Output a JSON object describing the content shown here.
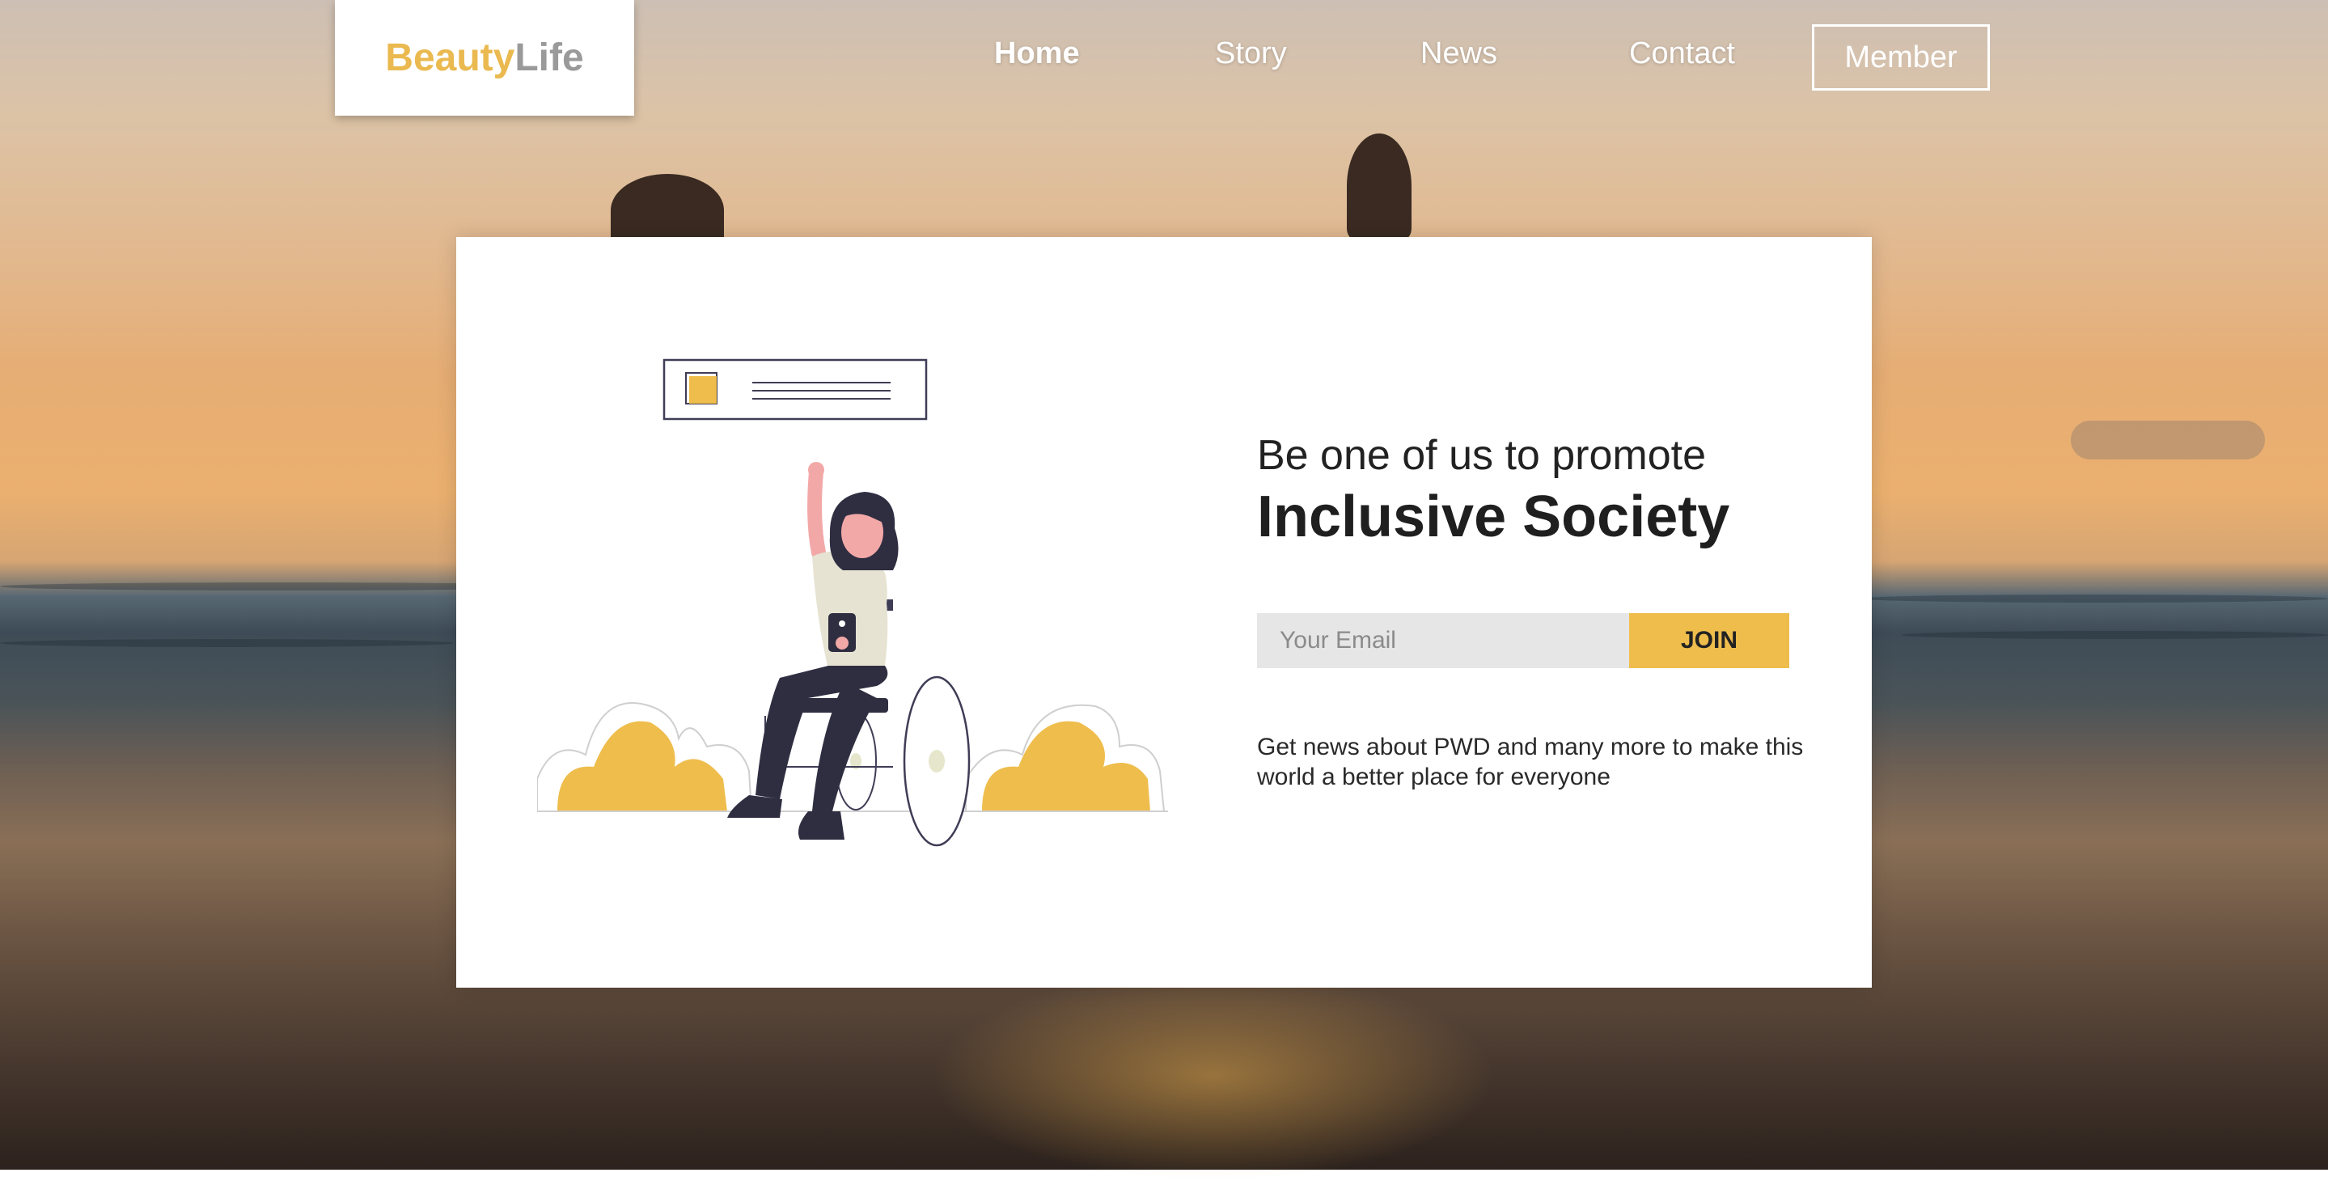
{
  "brand": {
    "part1": "Beauty",
    "part2": "Life"
  },
  "nav": {
    "items": [
      {
        "label": "Home",
        "active": true
      },
      {
        "label": "Story"
      },
      {
        "label": "News"
      },
      {
        "label": "Contact"
      }
    ],
    "member_label": "Member"
  },
  "hero": {
    "headline_line1": "Be one of us to promote",
    "headline_line2": "Inclusive Society",
    "email_placeholder": "Your Email",
    "join_label": "JOIN",
    "description": "Get news about PWD and many more to make this world a better place for everyone"
  },
  "colors": {
    "accent": "#eebd4c",
    "logo_secondary": "#9a9a9a",
    "text_dark": "#1f1f1f"
  },
  "icons": {
    "illustration": "woman-in-wheelchair-illustration"
  }
}
